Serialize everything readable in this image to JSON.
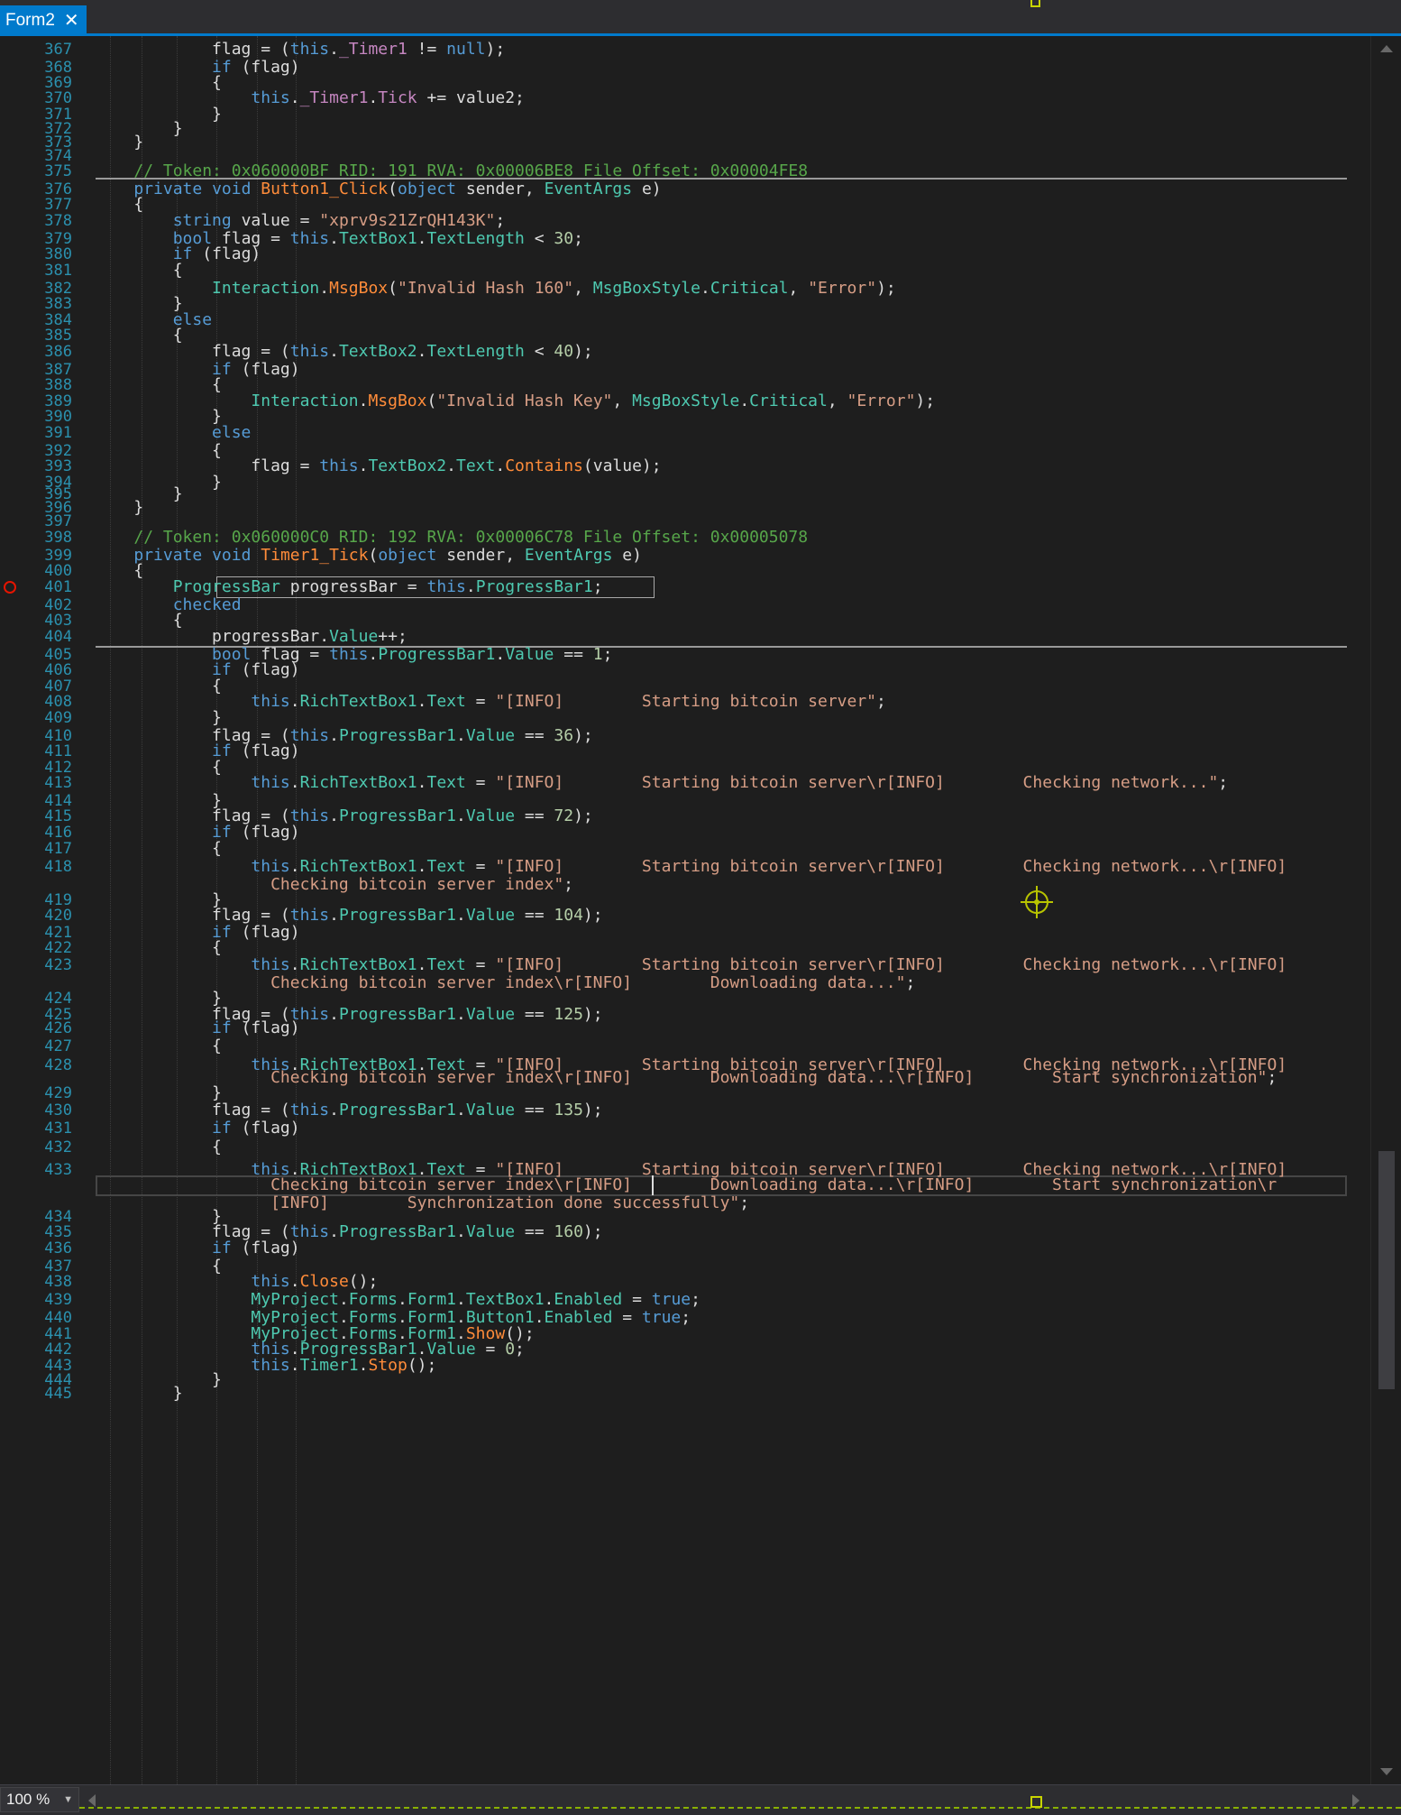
{
  "tab": {
    "title": "Form2",
    "close_glyph": "✕"
  },
  "zoom": {
    "value": "100 %"
  },
  "colors": {
    "accent": "#007acc",
    "background": "#1e1e1e",
    "keyword": "#569cd6",
    "type": "#4ec9b0",
    "method": "#ff8c3a",
    "string": "#d69d85",
    "number": "#b5cea8",
    "comment": "#57a64a",
    "line_number": "#2b91af",
    "breakpoint": "#e51400"
  },
  "icons": {
    "tab_close": "close-icon",
    "breakpoint": "breakpoint-icon",
    "cursor": "crosshair-cursor-icon",
    "zoom_dropdown": "chevron-down-icon"
  },
  "editor": {
    "breakpoint_line": "401",
    "lines": [
      {
        "n": "367",
        "c": "            flag = (this._Timer1 != null);"
      },
      {
        "n": "368",
        "c": "            if (flag)"
      },
      {
        "n": "369",
        "c": "            {"
      },
      {
        "n": "370",
        "c": "                this._Timer1.Tick += value2;"
      },
      {
        "n": "371",
        "c": "            }"
      },
      {
        "n": "372",
        "c": "        }"
      },
      {
        "n": "373",
        "c": "    }"
      },
      {
        "n": "374",
        "c": ""
      },
      {
        "n": "375",
        "c": "    // Token: 0x060000BF RID: 191 RVA: 0x00006BE8 File Offset: 0x00004FE8"
      },
      {
        "n": "376",
        "c": "    private void Button1_Click(object sender, EventArgs e)"
      },
      {
        "n": "377",
        "c": "    {"
      },
      {
        "n": "378",
        "c": "        string value = \"xprv9s21ZrQH143K\";"
      },
      {
        "n": "379",
        "c": "        bool flag = this.TextBox1.TextLength < 30;"
      },
      {
        "n": "380",
        "c": "        if (flag)"
      },
      {
        "n": "381",
        "c": "        {"
      },
      {
        "n": "382",
        "c": "            Interaction.MsgBox(\"Invalid Hash 160\", MsgBoxStyle.Critical, \"Error\");"
      },
      {
        "n": "383",
        "c": "        }"
      },
      {
        "n": "384",
        "c": "        else"
      },
      {
        "n": "385",
        "c": "        {"
      },
      {
        "n": "386",
        "c": "            flag = (this.TextBox2.TextLength < 40);"
      },
      {
        "n": "387",
        "c": "            if (flag)"
      },
      {
        "n": "388",
        "c": "            {"
      },
      {
        "n": "389",
        "c": "                Interaction.MsgBox(\"Invalid Hash Key\", MsgBoxStyle.Critical, \"Error\");"
      },
      {
        "n": "390",
        "c": "            }"
      },
      {
        "n": "391",
        "c": "            else"
      },
      {
        "n": "392",
        "c": "            {"
      },
      {
        "n": "393",
        "c": "                flag = this.TextBox2.Text.Contains(value);"
      },
      {
        "n": "394",
        "c": "            }"
      },
      {
        "n": "395",
        "c": "        }"
      },
      {
        "n": "396",
        "c": "    }"
      },
      {
        "n": "397",
        "c": ""
      },
      {
        "n": "398",
        "c": "    // Token: 0x060000C0 RID: 192 RVA: 0x00006C78 File Offset: 0x00005078"
      },
      {
        "n": "399",
        "c": "    private void Timer1_Tick(object sender, EventArgs e)"
      },
      {
        "n": "400",
        "c": "    {"
      },
      {
        "n": "401",
        "c": "        ProgressBar progressBar = this.ProgressBar1;"
      },
      {
        "n": "402",
        "c": "        checked"
      },
      {
        "n": "403",
        "c": "        {"
      },
      {
        "n": "404",
        "c": "            progressBar.Value++;"
      },
      {
        "n": "405",
        "c": "            bool flag = this.ProgressBar1.Value == 1;"
      },
      {
        "n": "406",
        "c": "            if (flag)"
      },
      {
        "n": "407",
        "c": "            {"
      },
      {
        "n": "408",
        "c": "                this.RichTextBox1.Text = \"[INFO]        Starting bitcoin server\";"
      },
      {
        "n": "409",
        "c": "            }"
      },
      {
        "n": "410",
        "c": "            flag = (this.ProgressBar1.Value == 36);"
      },
      {
        "n": "411",
        "c": "            if (flag)"
      },
      {
        "n": "412",
        "c": "            {"
      },
      {
        "n": "413",
        "c": "                this.RichTextBox1.Text = \"[INFO]        Starting bitcoin server\\r[INFO]        Checking network...\";"
      },
      {
        "n": "414",
        "c": "            }"
      },
      {
        "n": "415",
        "c": "            flag = (this.ProgressBar1.Value == 72);"
      },
      {
        "n": "416",
        "c": "            if (flag)"
      },
      {
        "n": "417",
        "c": "            {"
      },
      {
        "n": "418",
        "c": "                this.RichTextBox1.Text = \"[INFO]        Starting bitcoin server\\r[INFO]        Checking network...\\r[INFO]"
      },
      {
        "n": "",
        "c": "                  Checking bitcoin server index\";"
      },
      {
        "n": "419",
        "c": "            }"
      },
      {
        "n": "420",
        "c": "            flag = (this.ProgressBar1.Value == 104);"
      },
      {
        "n": "421",
        "c": "            if (flag)"
      },
      {
        "n": "422",
        "c": "            {"
      },
      {
        "n": "423",
        "c": "                this.RichTextBox1.Text = \"[INFO]        Starting bitcoin server\\r[INFO]        Checking network...\\r[INFO]"
      },
      {
        "n": "",
        "c": "                  Checking bitcoin server index\\r[INFO]        Downloading data...\";"
      },
      {
        "n": "424",
        "c": "            }"
      },
      {
        "n": "425",
        "c": "            flag = (this.ProgressBar1.Value == 125);"
      },
      {
        "n": "426",
        "c": "            if (flag)"
      },
      {
        "n": "427",
        "c": "            {"
      },
      {
        "n": "428",
        "c": "                this.RichTextBox1.Text = \"[INFO]        Starting bitcoin server\\r[INFO]        Checking network...\\r[INFO]"
      },
      {
        "n": "",
        "c": "                  Checking bitcoin server index\\r[INFO]        Downloading data...\\r[INFO]        Start synchronization\";"
      },
      {
        "n": "429",
        "c": "            }"
      },
      {
        "n": "430",
        "c": "            flag = (this.ProgressBar1.Value == 135);"
      },
      {
        "n": "431",
        "c": "            if (flag)"
      },
      {
        "n": "432",
        "c": "            {"
      },
      {
        "n": "433",
        "c": "                this.RichTextBox1.Text = \"[INFO]        Starting bitcoin server\\r[INFO]        Checking network...\\r[INFO]"
      },
      {
        "n": "",
        "c": "                  Checking bitcoin server index\\r[INFO]        Downloading data...\\r[INFO]        Start synchronization\\r"
      },
      {
        "n": "",
        "c": "                  [INFO]        Synchronization done successfully\";"
      },
      {
        "n": "434",
        "c": "            }"
      },
      {
        "n": "435",
        "c": "            flag = (this.ProgressBar1.Value == 160);"
      },
      {
        "n": "436",
        "c": "            if (flag)"
      },
      {
        "n": "437",
        "c": "            {"
      },
      {
        "n": "438",
        "c": "                this.Close();"
      },
      {
        "n": "439",
        "c": "                MyProject.Forms.Form1.TextBox1.Enabled = true;"
      },
      {
        "n": "440",
        "c": "                MyProject.Forms.Form1.Button1.Enabled = true;"
      },
      {
        "n": "441",
        "c": "                MyProject.Forms.Form1.Show();"
      },
      {
        "n": "442",
        "c": "                this.ProgressBar1.Value = 0;"
      },
      {
        "n": "443",
        "c": "                this.Timer1.Stop();"
      },
      {
        "n": "444",
        "c": "            }"
      },
      {
        "n": "445",
        "c": "        }"
      }
    ]
  }
}
